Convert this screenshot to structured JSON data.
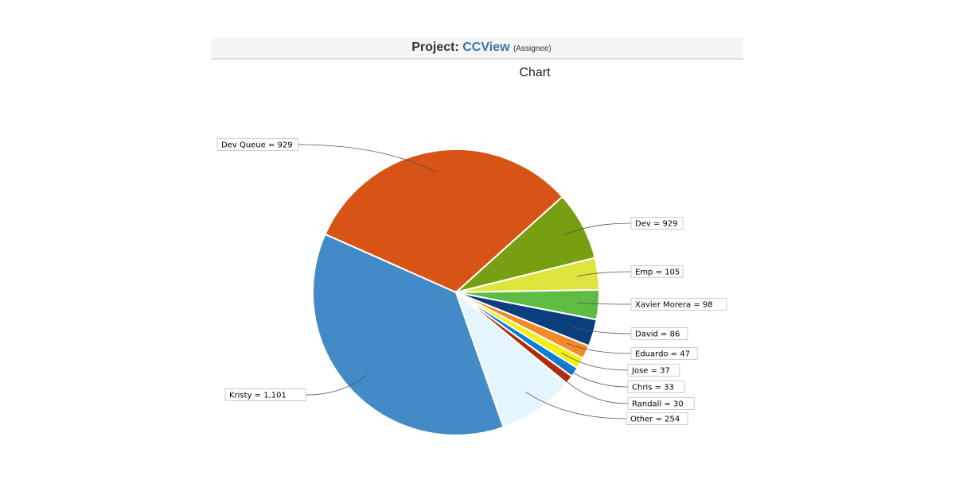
{
  "header": {
    "prefix": "Project: ",
    "project_name": "CCView",
    "suffix": "(Assignee)"
  },
  "chart_data": {
    "type": "pie",
    "title": "Chart",
    "slices": [
      {
        "label": "Kristy ",
        "value": 1101,
        "display": "1,101",
        "color": "#428bc7"
      },
      {
        "label": "Dev Queue",
        "value": 929,
        "display": "929",
        "color": "#d75316"
      },
      {
        "label": "Dev",
        "value": 929,
        "display": "929",
        "color": "#779f11"
      },
      {
        "label": "Emp",
        "value": 105,
        "display": "105",
        "color": "#dfe53e"
      },
      {
        "label": "Xavier Morera",
        "value": 98,
        "display": "98",
        "color": "#5ebc43"
      },
      {
        "label": "David",
        "value": 86,
        "display": "86",
        "color": "#0a3e7d"
      },
      {
        "label": "Eduardo",
        "value": 47,
        "display": "47",
        "color": "#f38a2a"
      },
      {
        "label": "Jose",
        "value": 37,
        "display": "37",
        "color": "#f1f012"
      },
      {
        "label": "Chris",
        "value": 33,
        "display": "33",
        "color": "#0d7ed4"
      },
      {
        "label": "Randall",
        "value": 30,
        "display": "30",
        "color": "#b5290b"
      },
      {
        "label": "Other",
        "value": 254,
        "display": "254",
        "color": "#e5f5fd"
      }
    ],
    "legend": "none",
    "data_labels": "outside-with-leaders"
  }
}
